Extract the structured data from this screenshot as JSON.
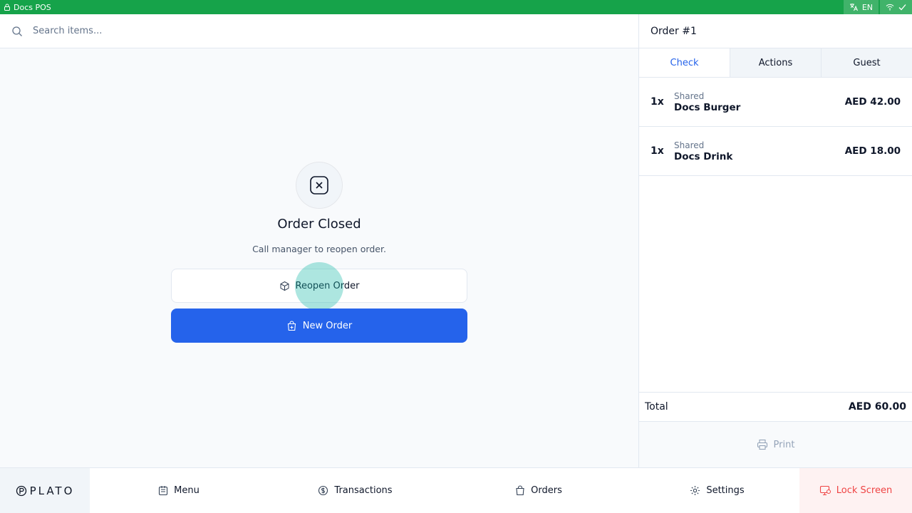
{
  "titlebar": {
    "app_name": "Docs POS",
    "language": "EN",
    "colors": {
      "background": "#16a34a"
    }
  },
  "search": {
    "placeholder": "Search items..."
  },
  "status": {
    "title": "Order Closed",
    "subtitle": "Call manager to reopen order.",
    "reopen_label": "Reopen Order",
    "new_order_label": "New Order"
  },
  "order": {
    "title": "Order #1",
    "tabs": [
      {
        "label": "Check",
        "active": true
      },
      {
        "label": "Actions",
        "active": false
      },
      {
        "label": "Guest",
        "active": false
      }
    ],
    "items": [
      {
        "qty": "1x",
        "group": "Shared",
        "name": "Docs Burger",
        "price": "AED 42.00"
      },
      {
        "qty": "1x",
        "group": "Shared",
        "name": "Docs Drink",
        "price": "AED 18.00"
      }
    ],
    "total_label": "Total",
    "total_value": "AED 60.00",
    "print_label": "Print"
  },
  "nav": {
    "logo": "PLATO",
    "items": [
      {
        "label": "Menu",
        "icon": "menu-book-icon"
      },
      {
        "label": "Transactions",
        "icon": "coin-icon"
      },
      {
        "label": "Orders",
        "icon": "bag-icon"
      },
      {
        "label": "Settings",
        "icon": "gear-icon"
      }
    ],
    "lock_label": "Lock Screen"
  },
  "colors": {
    "primary": "#2563eb",
    "accent_green": "#16a34a",
    "lock_bg": "#fef2f2",
    "lock_text": "#ef4444"
  }
}
